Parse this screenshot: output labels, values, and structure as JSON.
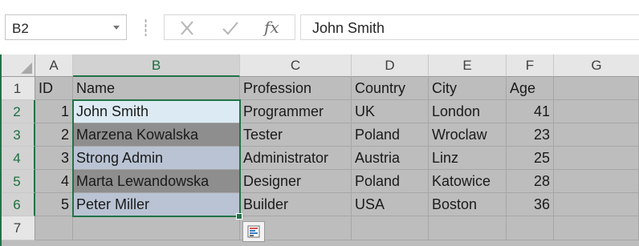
{
  "name_box": {
    "value": "B2"
  },
  "formula_bar": {
    "fx_label": "fx",
    "value": "John Smith"
  },
  "columns": [
    "A",
    "B",
    "C",
    "D",
    "E",
    "F",
    "G"
  ],
  "rows": [
    "1",
    "2",
    "3",
    "4",
    "5",
    "6",
    "7"
  ],
  "active_cell": "B2",
  "selection": "B2:B6",
  "table": {
    "headers": [
      "ID",
      "Name",
      "Profession",
      "Country",
      "City",
      "Age"
    ],
    "rows": [
      [
        "1",
        "John Smith",
        "Programmer",
        "UK",
        "London",
        "41"
      ],
      [
        "2",
        "Marzena Kowalska",
        "Tester",
        "Poland",
        "Wroclaw",
        "23"
      ],
      [
        "3",
        "Strong Admin",
        "Administrator",
        "Austria",
        "Linz",
        "25"
      ],
      [
        "4",
        "Marta Lewandowska",
        "Designer",
        "Poland",
        "Katowice",
        "28"
      ],
      [
        "5",
        "Peter Miller",
        "Builder",
        "USA",
        "Boston",
        "36"
      ]
    ]
  },
  "icons": {
    "cancel": "close-x-icon",
    "enter": "checkmark-icon",
    "insert_function": "fx-icon",
    "quick_analysis": "quick-analysis-icon",
    "name_box_dropdown": "chevron-down-icon",
    "select_all": "select-all-triangle-icon"
  },
  "colors": {
    "selection_border": "#217346",
    "selection_light": "#b9c3d3",
    "selection_dark": "#8e8e8e",
    "active_cell_fill": "#dcebf3",
    "sheet_background": "#bdbdbd"
  }
}
